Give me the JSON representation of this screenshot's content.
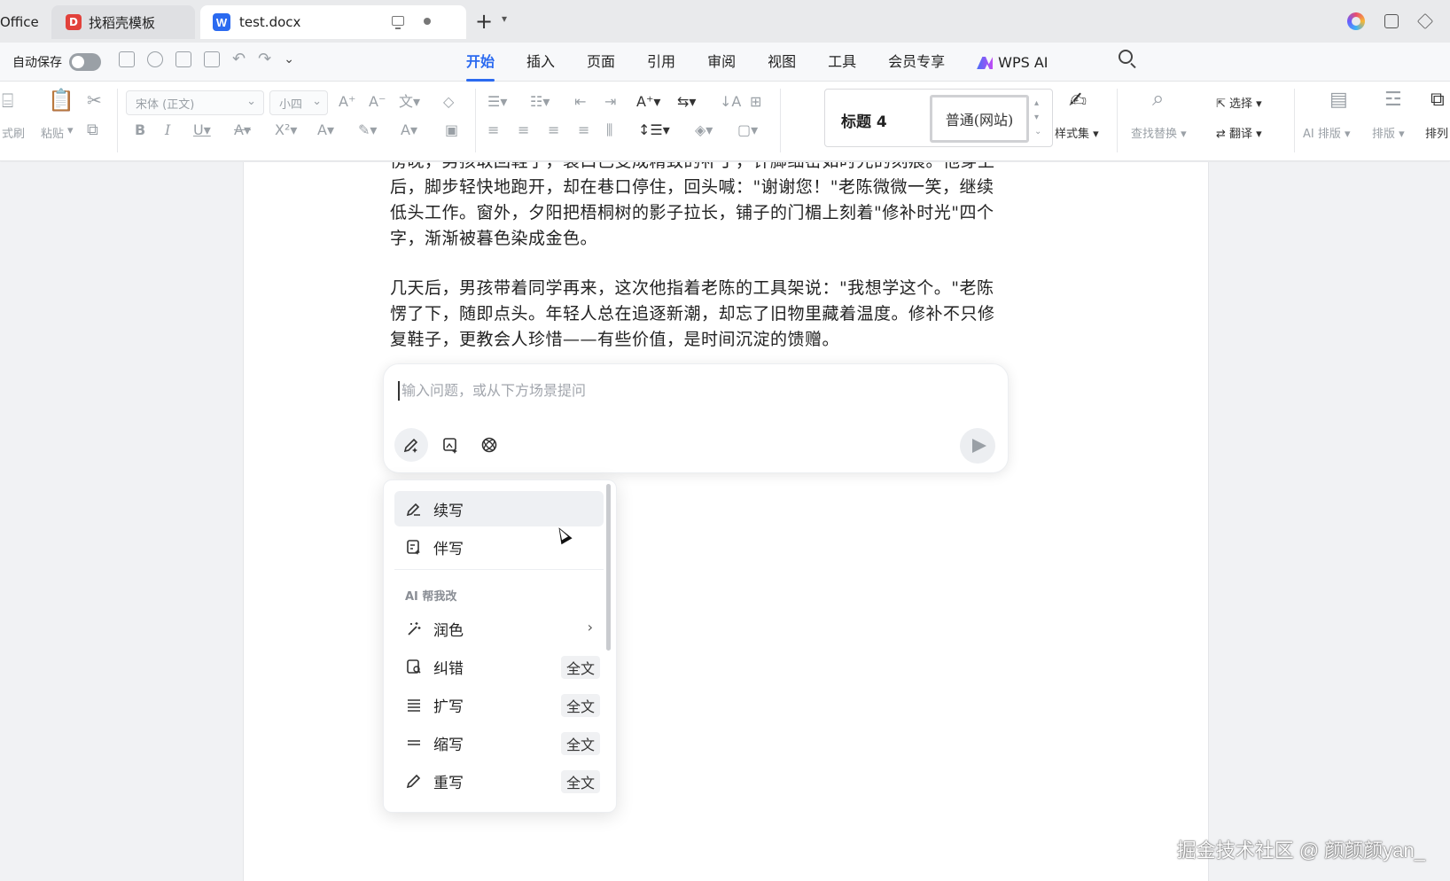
{
  "tabs": [
    {
      "label": "Office"
    },
    {
      "label": "找稻壳模板"
    },
    {
      "label": "test.docx"
    }
  ],
  "menubar": {
    "autosave_label": "自动保存",
    "tabs": [
      "开始",
      "插入",
      "页面",
      "引用",
      "审阅",
      "视图",
      "工具",
      "会员专享",
      "WPS AI"
    ],
    "active_tab": "开始"
  },
  "ribbon": {
    "format_painter": "式刷",
    "paste": "粘贴",
    "font_name": "宋体 (正文)",
    "font_size": "小四",
    "styles": {
      "heading": "标题 4",
      "normal": "普通(网站)"
    },
    "style_set": "样式集",
    "find_replace": "查找替换",
    "select": "选择",
    "translate": "翻译",
    "ai_layout": "AI 排版",
    "layout": "排版",
    "arrange": "排列"
  },
  "document": {
    "paragraph1_lines": [
      "傍晚，男孩取回鞋子，裂口已变成精致的补丁，针脚细密如时光的刻痕。他穿上",
      "后，脚步轻快地跑开，却在巷口停住，回头喊：\"谢谢您！\"老陈微微一笑，继续",
      "低头工作。窗外，夕阳把梧桐树的影子拉长，铺子的门楣上刻着\"修补时光\"四个",
      "字，渐渐被暮色染成金色。"
    ],
    "paragraph2_lines": [
      "几天后，男孩带着同学再来，这次他指着老陈的工具架说：\"我想学这个。\"老陈",
      "愣了下，随即点头。年轻人总在追逐新潮，却忘了旧物里藏着温度。修补不只修",
      "复鞋子，更教会人珍惜——有些价值，是时间沉淀的馈赠。"
    ]
  },
  "ai_input": {
    "placeholder": "输入问题，或从下方场景提问"
  },
  "ai_menu": {
    "continue_write": "续写",
    "co_write": "伴写",
    "section_title": "AI 帮我改",
    "items": [
      {
        "label": "润色",
        "badge": ""
      },
      {
        "label": "纠错",
        "badge": "全文"
      },
      {
        "label": "扩写",
        "badge": "全文"
      },
      {
        "label": "缩写",
        "badge": "全文"
      },
      {
        "label": "重写",
        "badge": "全文"
      }
    ]
  },
  "watermark": "掘金技术社区 @ 颜颜颜yan_",
  "colors": {
    "accent": "#2b6af0",
    "brand_red": "#e2413b"
  }
}
